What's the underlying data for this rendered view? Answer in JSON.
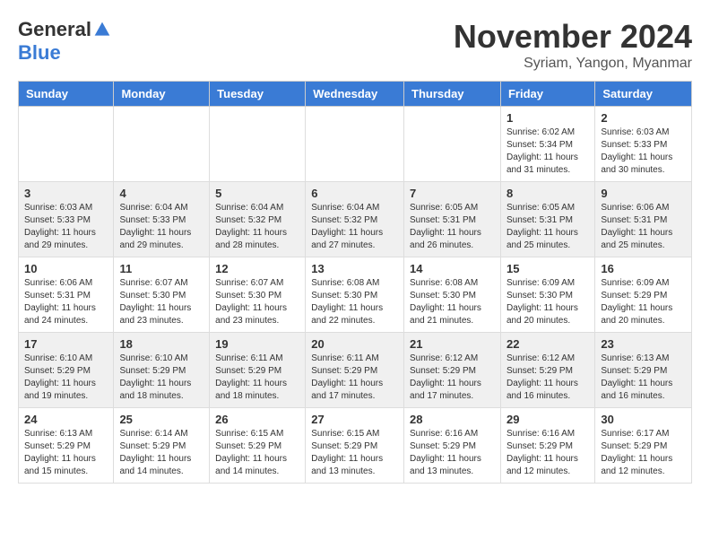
{
  "logo": {
    "general": "General",
    "blue": "Blue"
  },
  "header": {
    "month": "November 2024",
    "location": "Syriam, Yangon, Myanmar"
  },
  "days_of_week": [
    "Sunday",
    "Monday",
    "Tuesday",
    "Wednesday",
    "Thursday",
    "Friday",
    "Saturday"
  ],
  "weeks": [
    [
      {
        "day": "",
        "info": ""
      },
      {
        "day": "",
        "info": ""
      },
      {
        "day": "",
        "info": ""
      },
      {
        "day": "",
        "info": ""
      },
      {
        "day": "",
        "info": ""
      },
      {
        "day": "1",
        "info": "Sunrise: 6:02 AM\nSunset: 5:34 PM\nDaylight: 11 hours and 31 minutes."
      },
      {
        "day": "2",
        "info": "Sunrise: 6:03 AM\nSunset: 5:33 PM\nDaylight: 11 hours and 30 minutes."
      }
    ],
    [
      {
        "day": "3",
        "info": "Sunrise: 6:03 AM\nSunset: 5:33 PM\nDaylight: 11 hours and 29 minutes."
      },
      {
        "day": "4",
        "info": "Sunrise: 6:04 AM\nSunset: 5:33 PM\nDaylight: 11 hours and 29 minutes."
      },
      {
        "day": "5",
        "info": "Sunrise: 6:04 AM\nSunset: 5:32 PM\nDaylight: 11 hours and 28 minutes."
      },
      {
        "day": "6",
        "info": "Sunrise: 6:04 AM\nSunset: 5:32 PM\nDaylight: 11 hours and 27 minutes."
      },
      {
        "day": "7",
        "info": "Sunrise: 6:05 AM\nSunset: 5:31 PM\nDaylight: 11 hours and 26 minutes."
      },
      {
        "day": "8",
        "info": "Sunrise: 6:05 AM\nSunset: 5:31 PM\nDaylight: 11 hours and 25 minutes."
      },
      {
        "day": "9",
        "info": "Sunrise: 6:06 AM\nSunset: 5:31 PM\nDaylight: 11 hours and 25 minutes."
      }
    ],
    [
      {
        "day": "10",
        "info": "Sunrise: 6:06 AM\nSunset: 5:31 PM\nDaylight: 11 hours and 24 minutes."
      },
      {
        "day": "11",
        "info": "Sunrise: 6:07 AM\nSunset: 5:30 PM\nDaylight: 11 hours and 23 minutes."
      },
      {
        "day": "12",
        "info": "Sunrise: 6:07 AM\nSunset: 5:30 PM\nDaylight: 11 hours and 23 minutes."
      },
      {
        "day": "13",
        "info": "Sunrise: 6:08 AM\nSunset: 5:30 PM\nDaylight: 11 hours and 22 minutes."
      },
      {
        "day": "14",
        "info": "Sunrise: 6:08 AM\nSunset: 5:30 PM\nDaylight: 11 hours and 21 minutes."
      },
      {
        "day": "15",
        "info": "Sunrise: 6:09 AM\nSunset: 5:30 PM\nDaylight: 11 hours and 20 minutes."
      },
      {
        "day": "16",
        "info": "Sunrise: 6:09 AM\nSunset: 5:29 PM\nDaylight: 11 hours and 20 minutes."
      }
    ],
    [
      {
        "day": "17",
        "info": "Sunrise: 6:10 AM\nSunset: 5:29 PM\nDaylight: 11 hours and 19 minutes."
      },
      {
        "day": "18",
        "info": "Sunrise: 6:10 AM\nSunset: 5:29 PM\nDaylight: 11 hours and 18 minutes."
      },
      {
        "day": "19",
        "info": "Sunrise: 6:11 AM\nSunset: 5:29 PM\nDaylight: 11 hours and 18 minutes."
      },
      {
        "day": "20",
        "info": "Sunrise: 6:11 AM\nSunset: 5:29 PM\nDaylight: 11 hours and 17 minutes."
      },
      {
        "day": "21",
        "info": "Sunrise: 6:12 AM\nSunset: 5:29 PM\nDaylight: 11 hours and 17 minutes."
      },
      {
        "day": "22",
        "info": "Sunrise: 6:12 AM\nSunset: 5:29 PM\nDaylight: 11 hours and 16 minutes."
      },
      {
        "day": "23",
        "info": "Sunrise: 6:13 AM\nSunset: 5:29 PM\nDaylight: 11 hours and 16 minutes."
      }
    ],
    [
      {
        "day": "24",
        "info": "Sunrise: 6:13 AM\nSunset: 5:29 PM\nDaylight: 11 hours and 15 minutes."
      },
      {
        "day": "25",
        "info": "Sunrise: 6:14 AM\nSunset: 5:29 PM\nDaylight: 11 hours and 14 minutes."
      },
      {
        "day": "26",
        "info": "Sunrise: 6:15 AM\nSunset: 5:29 PM\nDaylight: 11 hours and 14 minutes."
      },
      {
        "day": "27",
        "info": "Sunrise: 6:15 AM\nSunset: 5:29 PM\nDaylight: 11 hours and 13 minutes."
      },
      {
        "day": "28",
        "info": "Sunrise: 6:16 AM\nSunset: 5:29 PM\nDaylight: 11 hours and 13 minutes."
      },
      {
        "day": "29",
        "info": "Sunrise: 6:16 AM\nSunset: 5:29 PM\nDaylight: 11 hours and 12 minutes."
      },
      {
        "day": "30",
        "info": "Sunrise: 6:17 AM\nSunset: 5:29 PM\nDaylight: 11 hours and 12 minutes."
      }
    ]
  ]
}
